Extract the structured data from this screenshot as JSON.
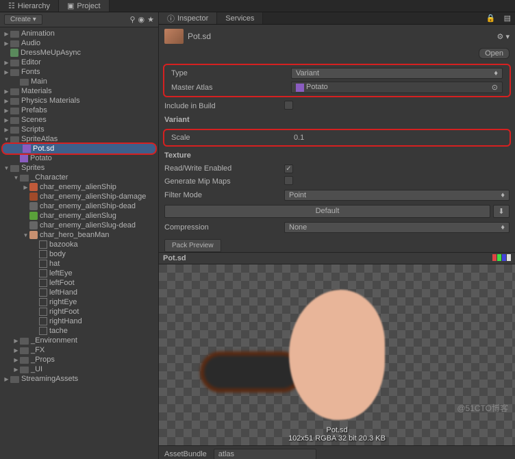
{
  "topTabs": {
    "hierarchy": "Hierarchy",
    "project": "Project"
  },
  "toolbar": {
    "create": "Create"
  },
  "tree": [
    {
      "l": 0,
      "f": "d",
      "t": "Animation"
    },
    {
      "l": 0,
      "f": "d",
      "t": "Audio"
    },
    {
      "l": 0,
      "f": "",
      "t": "DressMeUpAsync",
      "ico": "cs"
    },
    {
      "l": 0,
      "f": "d",
      "t": "Editor"
    },
    {
      "l": 0,
      "f": "d",
      "t": "Fonts"
    },
    {
      "l": 1,
      "f": "",
      "t": "Main"
    },
    {
      "l": 0,
      "f": "d",
      "t": "Materials"
    },
    {
      "l": 0,
      "f": "d",
      "t": "Physics Materials"
    },
    {
      "l": 0,
      "f": "d",
      "t": "Prefabs"
    },
    {
      "l": 0,
      "f": "d",
      "t": "Scenes"
    },
    {
      "l": 0,
      "f": "d",
      "t": "Scripts"
    },
    {
      "l": 0,
      "f": "d",
      "t": "SpriteAtlas",
      "open": true
    },
    {
      "l": 1,
      "f": "",
      "t": "Pot.sd",
      "ico": "atlas",
      "sel": true,
      "hl": true
    },
    {
      "l": 1,
      "f": "",
      "t": "Potato",
      "ico": "atlas"
    },
    {
      "l": 0,
      "f": "d",
      "t": "Sprites",
      "open": true
    },
    {
      "l": 1,
      "f": "d",
      "t": "_Character",
      "open": true
    },
    {
      "l": 2,
      "f": "r",
      "t": "char_enemy_alienShip",
      "c": "#c05a3a"
    },
    {
      "l": 2,
      "f": "",
      "t": "char_enemy_alienShip-damage",
      "c": "#a04a2a"
    },
    {
      "l": 2,
      "f": "",
      "t": "char_enemy_alienShip-dead",
      "c": "#666"
    },
    {
      "l": 2,
      "f": "",
      "t": "char_enemy_alienSlug",
      "c": "#5aa03a"
    },
    {
      "l": 2,
      "f": "",
      "t": "char_enemy_alienSlug-dead",
      "c": "#666"
    },
    {
      "l": 2,
      "f": "d",
      "t": "char_hero_beanMan",
      "open": true,
      "c": "#c89070"
    },
    {
      "l": 3,
      "f": "",
      "t": "bazooka",
      "ico": "sprite"
    },
    {
      "l": 3,
      "f": "",
      "t": "body",
      "ico": "sprite"
    },
    {
      "l": 3,
      "f": "",
      "t": "hat",
      "ico": "sprite"
    },
    {
      "l": 3,
      "f": "",
      "t": "leftEye",
      "ico": "sprite"
    },
    {
      "l": 3,
      "f": "",
      "t": "leftFoot",
      "ico": "sprite"
    },
    {
      "l": 3,
      "f": "",
      "t": "leftHand",
      "ico": "sprite"
    },
    {
      "l": 3,
      "f": "",
      "t": "rightEye",
      "ico": "sprite"
    },
    {
      "l": 3,
      "f": "",
      "t": "rightFoot",
      "ico": "sprite"
    },
    {
      "l": 3,
      "f": "",
      "t": "rightHand",
      "ico": "sprite"
    },
    {
      "l": 3,
      "f": "",
      "t": "tache",
      "ico": "sprite"
    },
    {
      "l": 1,
      "f": "d",
      "t": "_Environment"
    },
    {
      "l": 1,
      "f": "d",
      "t": "_FX"
    },
    {
      "l": 1,
      "f": "d",
      "t": "_Props"
    },
    {
      "l": 1,
      "f": "d",
      "t": "_UI"
    },
    {
      "l": 0,
      "f": "d",
      "t": "StreamingAssets"
    }
  ],
  "rightTabs": {
    "inspector": "Inspector",
    "services": "Services"
  },
  "header": {
    "title": "Pot.sd",
    "open": "Open"
  },
  "props": {
    "typeLabel": "Type",
    "typeValue": "Variant",
    "masterLabel": "Master Atlas",
    "masterValue": "Potato",
    "includeLabel": "Include in Build",
    "variantTitle": "Variant",
    "scaleLabel": "Scale",
    "scaleValue": "0.1",
    "textureTitle": "Texture",
    "rwLabel": "Read/Write Enabled",
    "mipLabel": "Generate Mip Maps",
    "filterLabel": "Filter Mode",
    "filterValue": "Point",
    "defaultBtn": "Default",
    "compLabel": "Compression",
    "compValue": "None",
    "packBtn": "Pack Preview"
  },
  "preview": {
    "title": "Pot.sd",
    "name": "Pot.sd",
    "info": "102x51 RGBA 32 bit    20.3 KB"
  },
  "footer": {
    "label": "AssetBundle",
    "value": "atlas"
  },
  "watermark": "@51CTO博客"
}
